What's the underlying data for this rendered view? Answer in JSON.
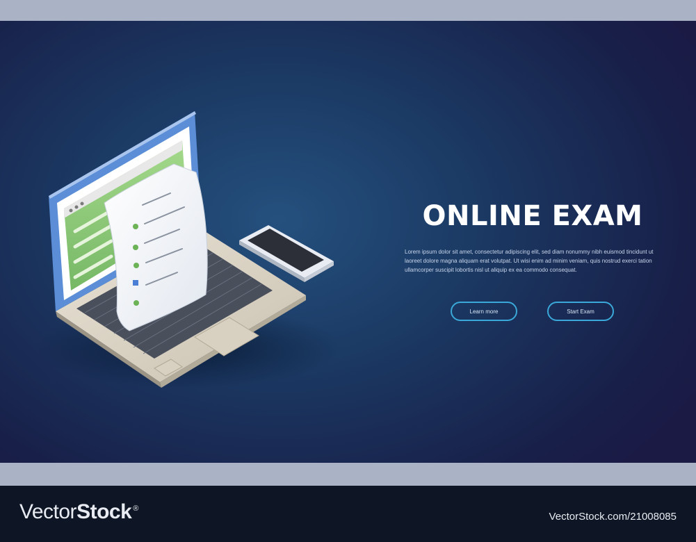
{
  "banner": {
    "headline": "ONLINE EXAM",
    "body_text": "Lorem ipsum dolor sit amet, consectetur adipiscing elit, sed diam nonummy nibh euismod tincidunt ut laoreet dolore magna aliquam erat volutpat. Ut wisi enim ad minim veniam, quis nostrud exerci tation ullamcorper suscipit lobortis nisl ut aliquip ex ea commodo consequat.",
    "buttons": [
      {
        "label": "Learn more"
      },
      {
        "label": "Start Exam"
      }
    ],
    "colors": {
      "background": "#1b3a64",
      "button_border": "#3aa8d8",
      "laptop_screen": "#8fc97a",
      "screen_frame": "#5b8ed6"
    },
    "icons": [
      "laptop-icon",
      "exam-checklist-icon",
      "smartphone-icon"
    ]
  },
  "footer": {
    "brand_light": "Vector",
    "brand_bold": "Stock",
    "brand_mark": "®",
    "url": "VectorStock.com/21008085"
  }
}
